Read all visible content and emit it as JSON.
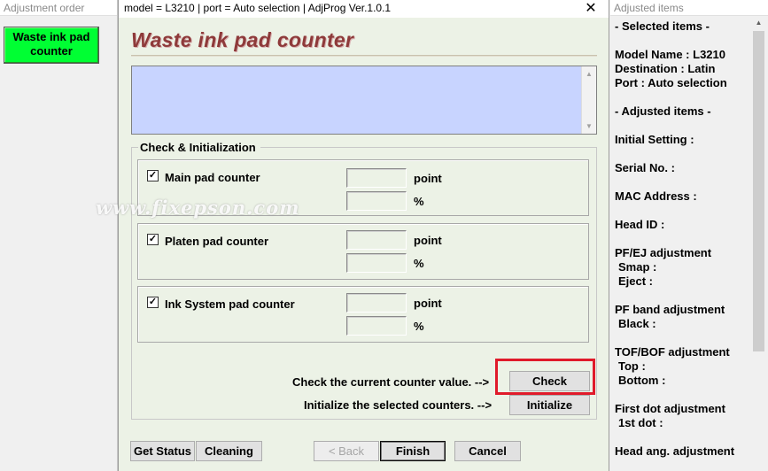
{
  "left_panel": {
    "title": "Adjustment order",
    "button_label_line1": "Waste ink pad",
    "button_label_line2": "counter",
    "button_color": "#00ff33"
  },
  "dialog": {
    "title": "model = L3210 | port = Auto selection | AdjProg Ver.1.0.1",
    "close_icon": "close-icon",
    "heading": "Waste ink pad counter",
    "group_title": "Check & Initialization",
    "counters": [
      {
        "label": "Main pad counter",
        "checked": true,
        "point": "",
        "percent": "",
        "unit_point": "point",
        "unit_percent": "%"
      },
      {
        "label": "Platen pad counter",
        "checked": true,
        "point": "",
        "percent": "",
        "unit_point": "point",
        "unit_percent": "%"
      },
      {
        "label": "Ink System pad counter",
        "checked": true,
        "point": "",
        "percent": "",
        "unit_point": "point",
        "unit_percent": "%"
      }
    ],
    "check_hint": "Check the current counter value. -->",
    "check_button": "Check",
    "init_hint": "Initialize the selected counters. -->",
    "init_button": "Initialize",
    "footer_buttons": {
      "get_status": "Get Status",
      "cleaning": "Cleaning",
      "back": "< Back",
      "finish": "Finish",
      "cancel": "Cancel"
    },
    "watermark": "www.fixepson.com",
    "heading_color": "#8e3a3a",
    "highlight_color": "#e01a2a"
  },
  "right_panel": {
    "title": "Adjusted items",
    "items": [
      "- Selected items -",
      "Model Name : L3210",
      "Destination : Latin",
      "Port : Auto selection",
      "- Adjusted items -",
      "Initial Setting :",
      "Serial No. :",
      "MAC Address :",
      "Head ID :",
      "PF/EJ adjustment",
      " Smap :",
      " Eject :",
      "PF band adjustment",
      " Black :",
      "TOF/BOF adjustment",
      " Top :",
      " Bottom :",
      "First dot adjustment",
      " 1st dot :",
      "Head ang. adjustment"
    ]
  }
}
